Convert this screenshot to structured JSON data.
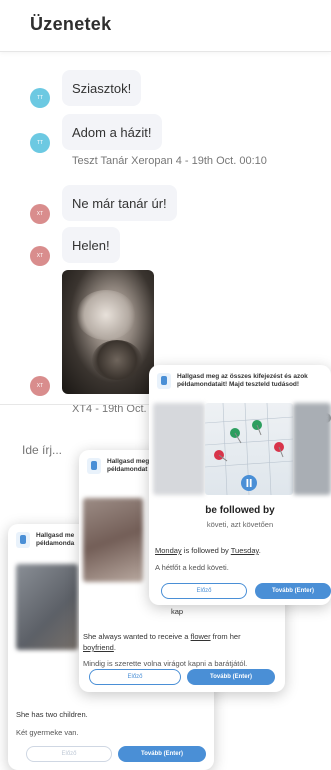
{
  "header": {
    "title": "Üzenetek"
  },
  "messages": [
    {
      "avatar": "TT",
      "text": "Sziasztok!"
    },
    {
      "avatar": "TT",
      "text": "Adom a házit!"
    },
    {
      "meta": "Teszt Tanár Xeropan 4 - 19th Oct. 00:10"
    },
    {
      "avatar": "XT",
      "text": "Ne már tanár úr!"
    },
    {
      "avatar": "XT",
      "text": "Helen!"
    },
    {
      "meta": "XT4 - 19th Oct."
    }
  ],
  "compose": {
    "placeholder": "Ide írj..."
  },
  "popups": {
    "front": {
      "header": "Hallgasd meg az összes kifejezést és azok példamondatait! Majd teszteld tudásod!",
      "word": "be followed by",
      "translation": "követi, azt követően",
      "example_pre": "",
      "example_link1": "Monday",
      "example_mid": " is followed by ",
      "example_link2": "Tuesday",
      "example_post": ".",
      "example_hu": "A hétfőt a kedd követi.",
      "back_label": "Előző",
      "next_label": "Tovább (Enter)",
      "play_icon": "pause"
    },
    "middle": {
      "header": "Hallgasd meg",
      "header2": "példamondat",
      "word_tail": "kap",
      "example_pre": "She always wanted to receive a ",
      "example_link1": "flower",
      "example_mid": " from her",
      "example_link2": "boyfriend",
      "example_post": ".",
      "example_hu": "Mindig is szerette volna virágot kapni a barátjától.",
      "back_label": "Előző",
      "next_label": "Tovább (Enter)"
    },
    "back": {
      "header": "Hallgasd me",
      "header2": "példamonda",
      "example": "She has two children.",
      "example_hu": "Két gyermeke van.",
      "back_label": "Előző",
      "next_label": "Tovább (Enter)"
    }
  },
  "colors": {
    "accent": "#4a8fd6",
    "avatar_teacher": "#6cc9e2",
    "avatar_student": "#d98d8d",
    "bubble": "#f3f4f8"
  }
}
